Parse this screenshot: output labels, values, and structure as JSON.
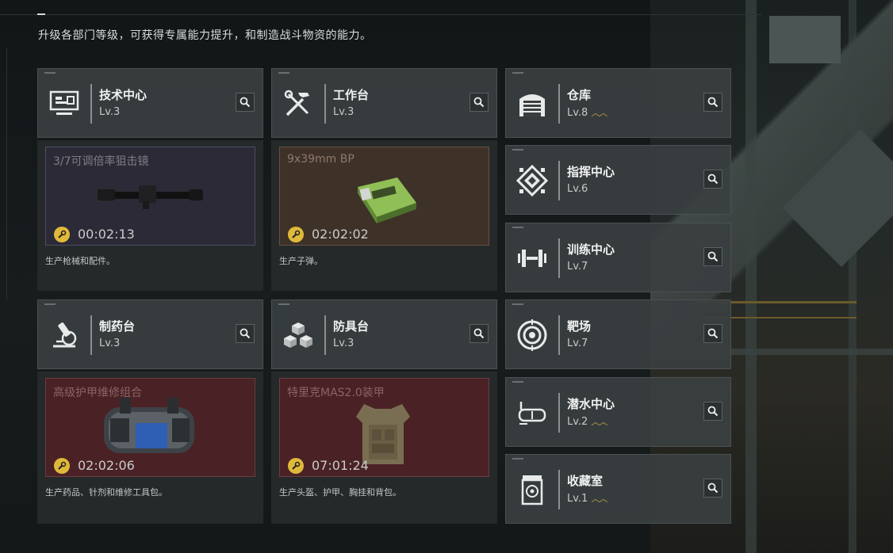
{
  "header": {
    "subtitle": "升级各部门等级，可获得专属能力提升，和制造战斗物资的能力。"
  },
  "colors": {
    "accent_gold": "#caa64a",
    "card_bg": "#3a3f40",
    "purple_rarity": "#2c2a37",
    "brown_rarity": "#3e3128",
    "red_rarity": "#4a2225"
  },
  "departments": {
    "tech": {
      "name": "技术中心",
      "level": "Lv.3",
      "icon": "computer-icon"
    },
    "workbench": {
      "name": "工作台",
      "level": "Lv.3",
      "icon": "hammer-wrench-icon"
    },
    "pharmacy": {
      "name": "制药台",
      "level": "Lv.3",
      "icon": "microscope-icon"
    },
    "armor": {
      "name": "防具台",
      "level": "Lv.3",
      "icon": "cubes-icon"
    },
    "warehouse": {
      "name": "仓库",
      "level": "Lv.8",
      "upgradable": true,
      "icon": "garage-icon"
    },
    "command": {
      "name": "指挥中心",
      "level": "Lv.6",
      "icon": "command-emblem-icon"
    },
    "training": {
      "name": "训练中心",
      "level": "Lv.7",
      "icon": "dumbbell-icon"
    },
    "range": {
      "name": "靶场",
      "level": "Lv.7",
      "icon": "target-icon"
    },
    "diving": {
      "name": "潜水中心",
      "level": "Lv.2",
      "upgradable": true,
      "icon": "diving-mask-icon"
    },
    "collection": {
      "name": "收藏室",
      "level": "Lv.1",
      "upgradable": true,
      "icon": "collection-icon"
    }
  },
  "production": {
    "tech": {
      "item": "3/7可调倍率狙击镜",
      "timer": "00:02:13",
      "desc": "生产枪械和配件。",
      "image": "scope-image"
    },
    "workbench": {
      "item": "9x39mm BP",
      "timer": "02:02:02",
      "desc": "生产子弹。",
      "image": "ammo-box-image"
    },
    "pharmacy": {
      "item": "高级护甲维修组合",
      "timer": "02:02:06",
      "desc": "生产药品、针剂和维修工具包。",
      "image": "repair-kit-image"
    },
    "armor": {
      "item": "特里克MAS2.0装甲",
      "timer": "07:01:24",
      "desc": "生产头盔、护甲、胸挂和背包。",
      "image": "body-armor-image"
    }
  }
}
